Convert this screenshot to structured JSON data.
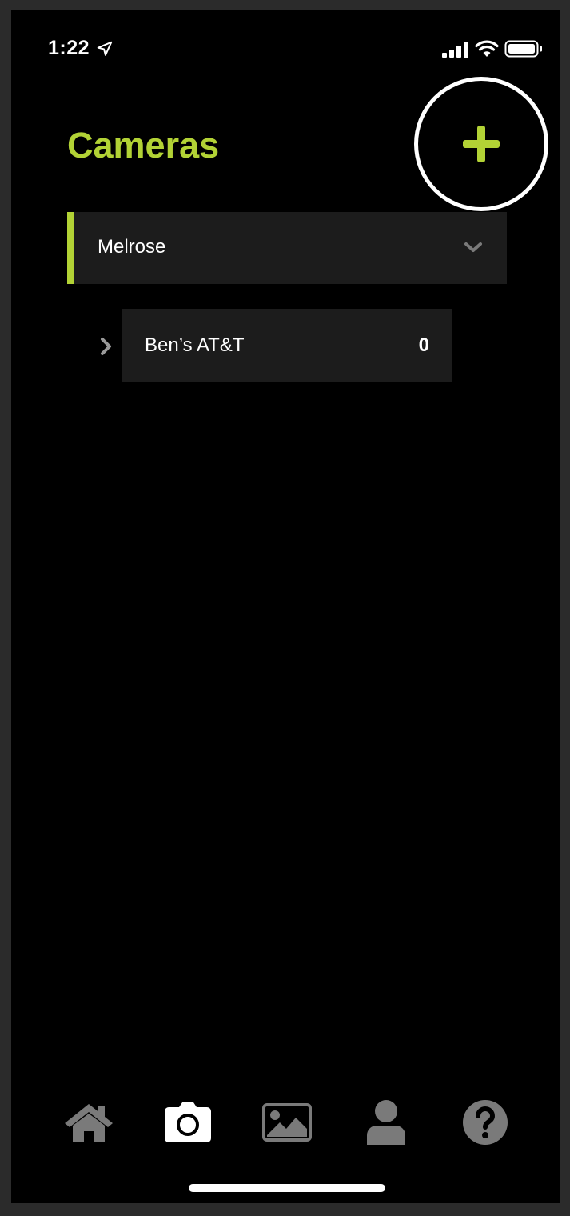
{
  "status_bar": {
    "time": "1:22",
    "icons": [
      "location-arrow-icon",
      "cellular-signal-icon",
      "wifi-icon",
      "battery-icon"
    ]
  },
  "header": {
    "title": "Cameras",
    "add_icon": "plus-icon"
  },
  "groups": [
    {
      "label": "Melrose",
      "expanded": true,
      "chevron_icon": "chevron-down-icon",
      "items": [
        {
          "label": "Ben’s AT&T",
          "count": "0",
          "chevron_icon": "chevron-right-icon"
        }
      ]
    }
  ],
  "tab_bar": {
    "active": "camera",
    "tabs": [
      {
        "id": "home",
        "icon": "home-icon"
      },
      {
        "id": "camera",
        "icon": "camera-icon"
      },
      {
        "id": "gallery",
        "icon": "gallery-icon"
      },
      {
        "id": "profile",
        "icon": "profile-icon"
      },
      {
        "id": "help",
        "icon": "help-icon"
      }
    ]
  },
  "colors": {
    "accent": "#b2d235",
    "background": "#000000",
    "row_background": "#1c1c1c",
    "inactive_icon": "#7a7a7a",
    "active_icon": "#ffffff"
  }
}
